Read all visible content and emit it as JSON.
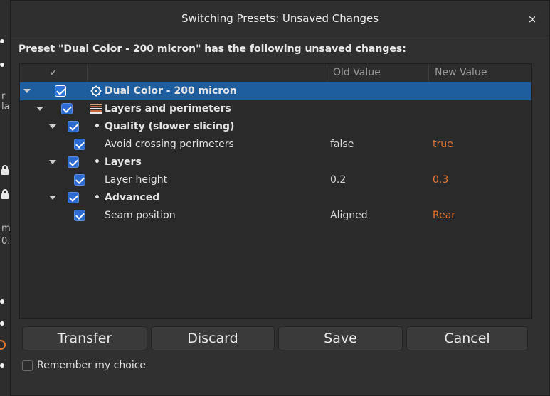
{
  "background": {
    "fragments": [
      "r la",
      "m",
      "0."
    ]
  },
  "dialog": {
    "title": "Switching Presets: Unsaved Changes",
    "close_label": "×",
    "message": "Preset \"Dual Color - 200 micron\" has the following unsaved changes:",
    "columns": {
      "check": "✔",
      "name": "",
      "old": "Old Value",
      "new": "New Value"
    },
    "rows": [
      {
        "label": "Dual Color - 200 micron",
        "icon": "gear-icon",
        "old": "",
        "new": "",
        "checked": true,
        "selected": true
      },
      {
        "label": "Layers and perimeters",
        "icon": "layers-icon",
        "old": "",
        "new": "",
        "checked": true
      },
      {
        "label": "Quality (slower slicing)",
        "bullet": "•",
        "old": "",
        "new": "",
        "checked": true
      },
      {
        "label": "Avoid crossing perimeters",
        "old": "false",
        "new": "true",
        "checked": true
      },
      {
        "label": "Layers",
        "bullet": "•",
        "old": "",
        "new": "",
        "checked": true
      },
      {
        "label": "Layer height",
        "old": "0.2",
        "new": "0.3",
        "checked": true
      },
      {
        "label": "Advanced",
        "bullet": "•",
        "old": "",
        "new": "",
        "checked": true
      },
      {
        "label": "Seam position",
        "old": "Aligned",
        "new": "Rear",
        "checked": true
      }
    ],
    "buttons": {
      "transfer": "Transfer",
      "discard": "Discard",
      "save": "Save",
      "cancel": "Cancel"
    },
    "remember_label": "Remember my choice",
    "remember_checked": false
  },
  "colors": {
    "accent": "#1f5e9e",
    "checkbox": "#2e6bd1",
    "new_value": "#e8772e"
  }
}
